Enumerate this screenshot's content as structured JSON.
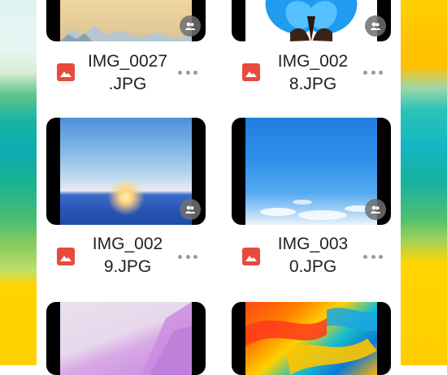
{
  "files": [
    {
      "name_line1": "IMG_0027",
      "name_line2": ".JPG",
      "picture": "desert-mountain",
      "shared": true
    },
    {
      "name_line1": "IMG_002",
      "name_line2": "8.JPG",
      "picture": "blue-butterfly",
      "shared": true
    },
    {
      "name_line1": "IMG_002",
      "name_line2": "9.JPG",
      "picture": "sea-sunrise",
      "shared": true
    },
    {
      "name_line1": "IMG_003",
      "name_line2": "0.JPG",
      "picture": "blue-sky",
      "shared": true
    },
    {
      "name_line1": "",
      "name_line2": "",
      "picture": "pink-abstract",
      "shared": false
    },
    {
      "name_line1": "",
      "name_line2": "",
      "picture": "colorful-feathers",
      "shared": false
    }
  ],
  "icons": {
    "file_type": "image-icon",
    "share": "shared-users-icon",
    "more": "more-options-icon"
  },
  "colors": {
    "image_icon": "#e84a3d",
    "text": "#222222",
    "more_dots": "#9a9a9a"
  }
}
